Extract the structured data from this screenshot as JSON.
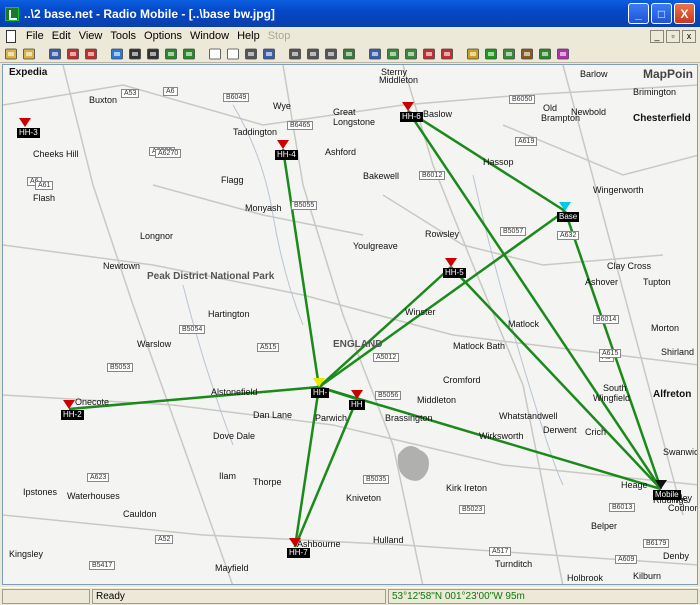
{
  "window": {
    "title": "..\\2 base.net - Radio Mobile - [..\\base bw.jpg]",
    "buttons": [
      "_",
      "□",
      "X"
    ]
  },
  "menu": {
    "items": [
      {
        "label": "File",
        "enabled": true
      },
      {
        "label": "Edit",
        "enabled": true
      },
      {
        "label": "View",
        "enabled": true
      },
      {
        "label": "Tools",
        "enabled": true
      },
      {
        "label": "Options",
        "enabled": true
      },
      {
        "label": "Window",
        "enabled": true
      },
      {
        "label": "Help",
        "enabled": true
      },
      {
        "label": "Stop",
        "enabled": false
      }
    ],
    "mdi": [
      "_",
      "▫",
      "x"
    ]
  },
  "toolbar": {
    "icons": [
      "new-icon",
      "open-icon",
      "save-icon",
      "unit-delete-icon",
      "unit-add-icon",
      "world-icon",
      "properties-icon",
      "camera-icon",
      "back-icon",
      "forward-icon",
      "blank-map-icon",
      "copy-map-icon",
      "paste-icon",
      "save-map-icon",
      "print-icon",
      "copy-icon",
      "copy-all-icon",
      "landscape-icon",
      "view-icon",
      "elevation-icon",
      "select-area-icon",
      "antenna-icon",
      "delete-area-icon",
      "radio-link-icon",
      "coverage-icon",
      "polar-icon",
      "route-icon",
      "network-icon",
      "plugin-icon"
    ]
  },
  "map": {
    "brand": "MapPoin",
    "stations": [
      {
        "id": "HH-3",
        "label": "HH-3",
        "color": "#cc0000"
      },
      {
        "id": "HH-4",
        "label": "HH-4",
        "color": "#cc0000"
      },
      {
        "id": "HH-6",
        "label": "HH-6",
        "color": "#cc0000"
      },
      {
        "id": "HH-5",
        "label": "HH-5",
        "color": "#cc0000"
      },
      {
        "id": "Base",
        "label": "Base",
        "color": "#00c8e8"
      },
      {
        "id": "HH-2",
        "label": "HH-2",
        "color": "#cc0000"
      },
      {
        "id": "HH-center",
        "label": "HH-",
        "color": "#e8e800"
      },
      {
        "id": "HH",
        "label": "HH",
        "color": "#cc0000"
      },
      {
        "id": "HH-7",
        "label": "HH-7",
        "color": "#cc0000"
      },
      {
        "id": "Mobile",
        "label": "Mobile",
        "color": "#111111"
      }
    ],
    "places": [
      "Expedia",
      "Buxton",
      "Sterny",
      "Middleton",
      "Barlow",
      "Brimington",
      "Chesterfield",
      "Great",
      "Longstone",
      "Baslow",
      "Old",
      "Brampton",
      "Newbold",
      "Taddington",
      "Cheeks Hill",
      "Ashford",
      "Flagg",
      "Bakewell",
      "Flash",
      "Monyash",
      "Wingerworth",
      "Longnor",
      "Youlgreave",
      "Rowsley",
      "Newtown",
      "Peak District National Park",
      "Clay Cross",
      "Hartington",
      "Winster",
      "Ashover",
      "Tupton",
      "Matlock",
      "Morton",
      "Warslow",
      "ENGLAND",
      "Matlock Bath",
      "Shirland",
      "Alstonefield",
      "Cromford",
      "South",
      "Wingfield",
      "Alfreton",
      "Onecote",
      "Parwich",
      "Dan Lane",
      "Middleton",
      "Brassington",
      "Whatstandwell",
      "Dove Dale",
      "Wirksworth",
      "Crich",
      "Swanwick",
      "Ilam",
      "Thorpe",
      "Kirk Ireton",
      "Heage",
      "Riddings",
      "Ipstones",
      "Waterhouses",
      "Kniveton",
      "Ripley",
      "Cauldon",
      "Codnor",
      "Ashbourne",
      "Hulland",
      "Belper",
      "Kingsley",
      "Mayfield",
      "Turnditch",
      "Denby",
      "Holbrook",
      "Kilburn",
      "Hassop",
      "Wye",
      "Derwent"
    ],
    "roads": [
      "A6",
      "B6049",
      "B6465",
      "A6020",
      "B6050",
      "A619",
      "A6270",
      "A6",
      "A61",
      "A53",
      "B5055",
      "B6012",
      "B5057",
      "B5056",
      "A623",
      "A632",
      "B6014",
      "B5054",
      "A515",
      "A5012",
      "B5053",
      "B5035",
      "A6",
      "A615",
      "B6013",
      "B5023",
      "A52",
      "A517",
      "B6179",
      "A609",
      "B5417"
    ]
  },
  "status": {
    "state": "Ready",
    "coordinates": "53°12'58\"N 001°23'00\"W 95m"
  }
}
